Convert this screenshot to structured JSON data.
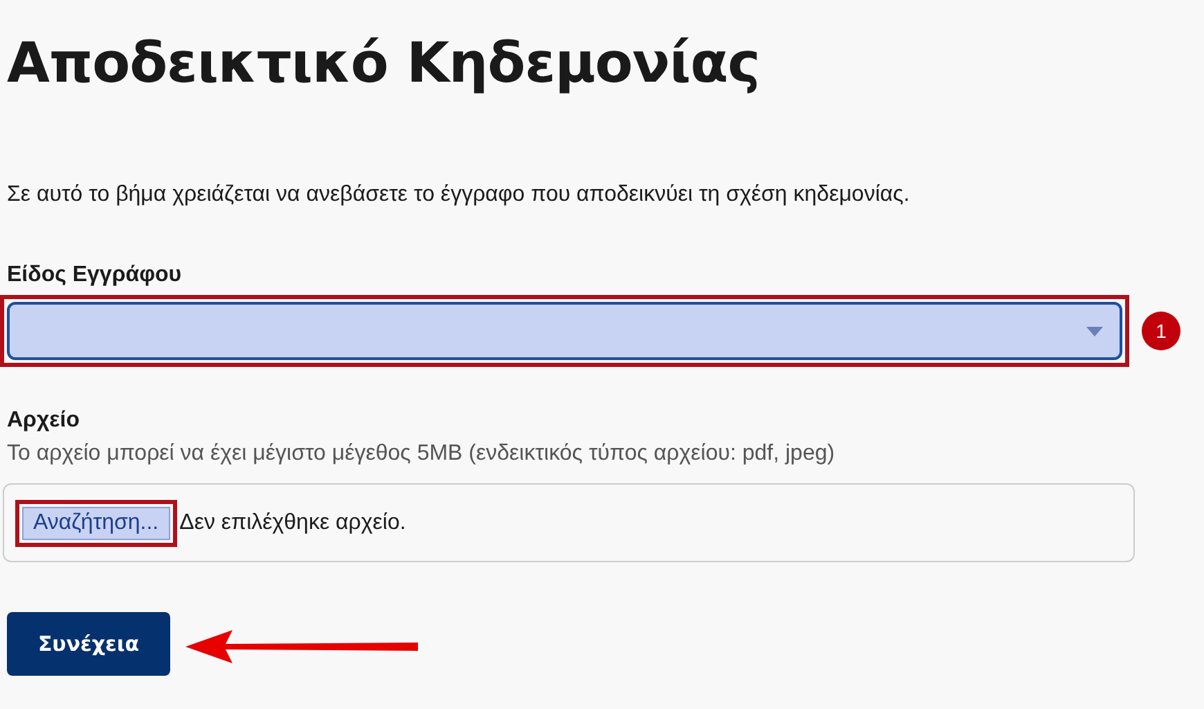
{
  "title": "Αποδεικτικό Κηδεμονίας",
  "intro": "Σε αυτό το βήμα χρειάζεται να ανεβάσετε το έγγραφο που αποδεικνύει τη σχέση κηδεμονίας.",
  "document_type": {
    "label": "Είδος Εγγράφου",
    "highlighted": true,
    "badge": "1"
  },
  "file": {
    "label": "Αρχείο",
    "hint": "Το αρχείο μπορεί να έχει μέγιστο μέγεθος 5MB (ενδεικτικός τύπος αρχείου: pdf, jpeg)",
    "browse_button": "Αναζήτηση...",
    "browse_highlighted": true,
    "status": "Δεν επιλέχθηκε αρχείο."
  },
  "continue_button": "Συνέχεια"
}
